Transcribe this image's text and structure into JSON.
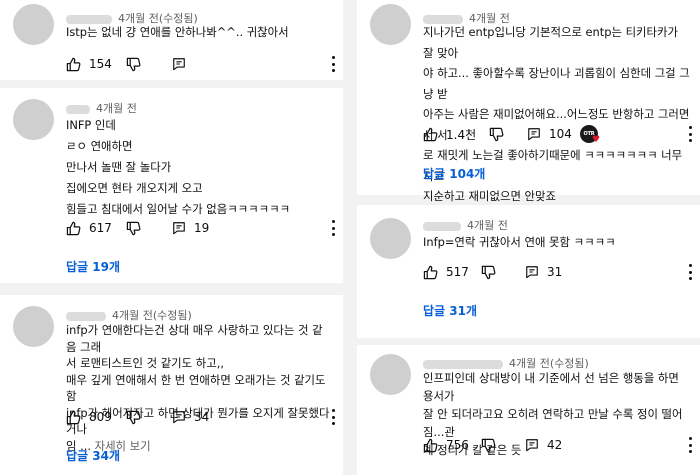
{
  "colors": {
    "background": "#f2f2f2",
    "card": "#ffffff",
    "reply_link": "#065fd4",
    "meta_text": "#606060",
    "heart": "#e01a2b"
  },
  "icons": {
    "like": "thumbs-up-icon",
    "dislike": "thumbs-down-icon",
    "reply": "reply-icon",
    "more": "kebab-menu-icon"
  },
  "left": [
    {
      "time": "4개월 전(수정됨)",
      "text": "Istp는 없네 걍 연애를 안하나봐^^.. 귀찮아서",
      "likes": "154",
      "replies_label": ""
    },
    {
      "time": "4개월 전",
      "text": "INFP 인데\nㄹㅇ 연애하면\n만나서 놀땐 잘 놀다가\n집에오면 현타 개오지게 오고\n힘들고 침대에서 일어날 수가 없음ㅋㅋㅋㅋㅋㅋ",
      "likes": "617",
      "reply_count": "19",
      "replies_label": "답글 19개"
    },
    {
      "time": "4개월 전(수정됨)",
      "text": "infp가 연애한다는건 상대 매우 사랑하고 있다는 것 같음 그래\n서 로맨티스트인 것 같기도 하고,,\n매우 깊게 연애해서 한 번 연애하면 오래가는 것 같기도 함\ninfp가 헤어지자고 하면 상대가 뭔가를 오지게 잘못했다거나\n임 ...",
      "more_label": "자세히 보기",
      "likes": "809",
      "reply_count": "34",
      "replies_label": "답글 34개"
    }
  ],
  "right": [
    {
      "time": "4개월 전",
      "text": "지나가던 entp입니당 기본적으로 entp는 티키타카가 잘 맞아\n야 하고... 좋아할수록 장난이나 괴롭힘이 심한데 그걸 그냥 받\n아주는 사람은 재미없어해요...어느정도 반항하고 그러면서 서\n로 재밋게 노는걸 좋아하기때문에 ㅋㅋㅋㅋㅋㅋㅋ 너무 지고\n지순하고 재미없으면 안맞죠",
      "likes": "1.4천",
      "reply_count": "104",
      "creator_badge": "OTR",
      "replies_label": "답글 104개"
    },
    {
      "time": "4개월 전",
      "text": "Infp=연락 귀찮아서 연애 못함 ㅋㅋㅋㅋ",
      "likes": "517",
      "reply_count": "31",
      "replies_label": "답글 31개"
    },
    {
      "time": "4개월 전(수정됨)",
      "text": "인프피인데 상대방이 내 기준에서 선 넘은 행동을 하면 용서가\n잘 안 되더라고요 오히려 연락하고 만날 수록 정이 떨어짐...관\n계 정리가 칼 같은 듯",
      "likes": "756",
      "reply_count": "42",
      "replies_label": ""
    }
  ]
}
